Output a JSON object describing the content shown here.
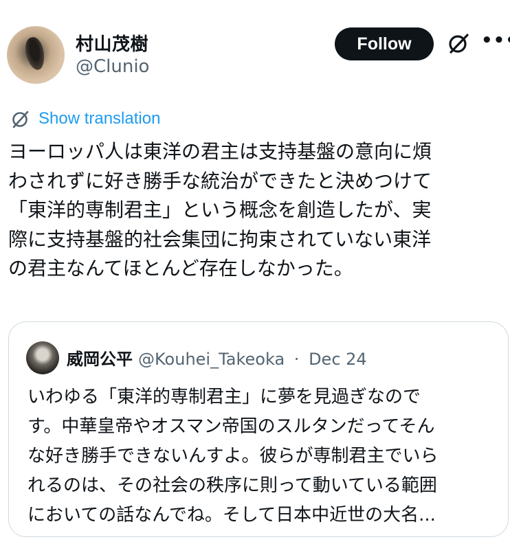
{
  "author": {
    "display_name": "村山茂樹",
    "handle": "@Clunio"
  },
  "actions": {
    "follow_label": "Follow",
    "more_label": "•••"
  },
  "translation": {
    "label": "Show translation"
  },
  "tweet": {
    "lines": [
      "ヨーロッパ人は東洋の君主は支持基盤の意向に煩",
      "わされずに好き勝手な統治ができたと決めつけて",
      "「東洋的専制君主」という概念を創造したが、実",
      "際に支持基盤的社会集団に拘束されていない東洋",
      "の君主なんてほとんど存在しなかった。"
    ]
  },
  "quote": {
    "display_name": "威岡公平",
    "handle": "@Kouhei_Takeoka",
    "separator": "·",
    "date": "Dec 24",
    "lines": [
      "いわゆる「東洋的専制君主」に夢を見過ぎなので",
      "す。中華皇帝やオスマン帝国のスルタンだってそん",
      "な好き勝手できないんすよ。彼らが専制君主でいら",
      "れるのは、その社会の秩序に則って動いている範囲",
      "においての話なんでね。そして日本中近世の大名..."
    ]
  },
  "icons": {
    "grok": "grok-icon",
    "more": "more-icon",
    "translate": "translate-icon"
  },
  "colors": {
    "link": "#1d9bf0",
    "secondary_text": "#536471",
    "primary_text": "#0f1419",
    "border": "#cfd9de"
  }
}
